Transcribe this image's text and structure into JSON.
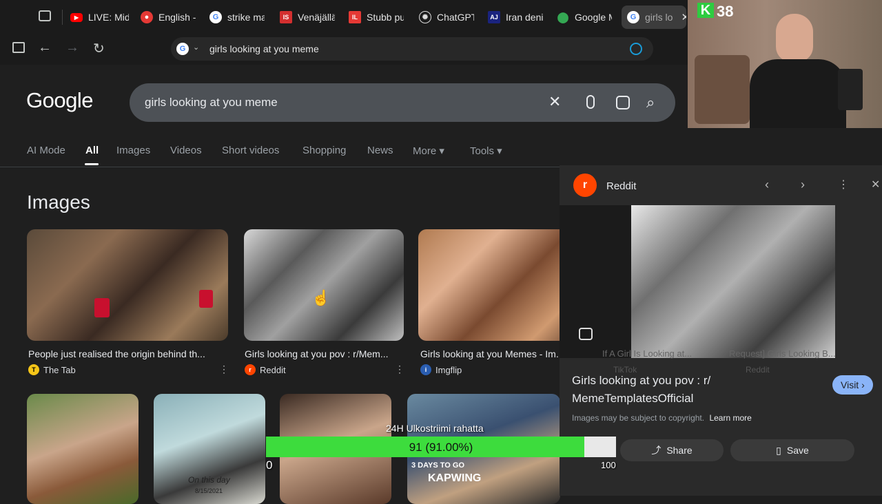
{
  "tabs": [
    {
      "label": "LIVE: Mid",
      "icon": "youtube-icon"
    },
    {
      "label": "English -",
      "icon": "dictionary-icon"
    },
    {
      "label": "strike ma",
      "icon": "google-icon"
    },
    {
      "label": "Venäjällä",
      "icon": "is-news-icon"
    },
    {
      "label": "Stubb pu",
      "icon": "il-news-icon"
    },
    {
      "label": "ChatGPT",
      "icon": "chatgpt-icon"
    },
    {
      "label": "Iran deni",
      "icon": "news-icon"
    },
    {
      "label": "Google M",
      "icon": "google-maps-icon"
    },
    {
      "label": "girls lo",
      "icon": "google-icon"
    }
  ],
  "omnibox": {
    "url": "girls looking at you meme"
  },
  "google": {
    "logo": "Google",
    "query": "girls looking at you meme",
    "nav": [
      "AI Mode",
      "All",
      "Images",
      "Videos",
      "Short videos",
      "Shopping",
      "News",
      "More ▾",
      "Tools ▾"
    ],
    "section_title": "Images"
  },
  "results": [
    {
      "caption": "People just realised the origin behind th...",
      "source": "The Tab",
      "source_icon": "T"
    },
    {
      "caption": "Girls looking at you pov : r/Mem...",
      "source": "Reddit",
      "source_icon": "r"
    },
    {
      "caption": "Girls looking at you Memes - Im...",
      "source": "Imgflip",
      "source_icon": "i"
    }
  ],
  "panel": {
    "source": "Reddit",
    "title": "Girls looking at you pov : r/ MemeTemplatesOfficial",
    "copyright": "Images may be subject to copyright.",
    "learn_more": "Learn more",
    "visit": "Visit ›",
    "share": "Share",
    "save": "Save",
    "bg_caption_1": "If A Girl Is Looking at...",
    "bg_caption_2": "Request] Girls Looking B...",
    "bg_source_1": "TikTok",
    "bg_source_2": "Reddit"
  },
  "stream": {
    "counter": "38",
    "progress_title": "24H Ulkostriimi rahatta",
    "progress_text": "91 (91.00%)",
    "progress_value": 0.91,
    "progress_min": "0",
    "progress_max": "100",
    "thumb_label_1": "3 DAYS TO GO",
    "thumb_label_2": "KAPWING",
    "thumb_label_3": "On this day",
    "thumb_label_4": "8/15/2021"
  },
  "colors": {
    "accent_green": "#3ddc3d",
    "google_bg": "#1f1f1f",
    "counter_green": "#2ecc40"
  }
}
